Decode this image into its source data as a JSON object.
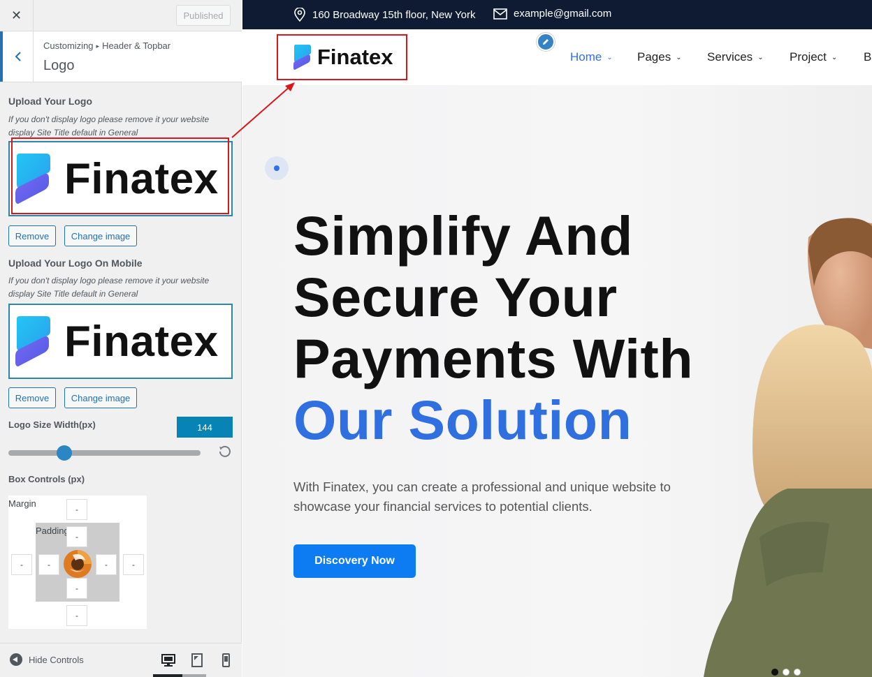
{
  "customizer": {
    "close_glyph": "✕",
    "published_label": "Published",
    "breadcrumb": {
      "root": "Customizing",
      "section": "Header & Topbar"
    },
    "section_title": "Logo",
    "logo": {
      "label": "Upload Your Logo",
      "description": "If you don't display logo please remove it your website display Site Title default in General",
      "preview_text": "Finatex",
      "remove_label": "Remove",
      "change_label": "Change image"
    },
    "mobile_logo": {
      "label": "Upload Your Logo On Mobile",
      "description": "If you don't display logo please remove it your website display Site Title default in General",
      "preview_text": "Finatex",
      "remove_label": "Remove",
      "change_label": "Change image"
    },
    "logo_width": {
      "label": "Logo Size Width(px)",
      "value": "144",
      "slider_fraction": 0.29
    },
    "box_controls": {
      "label": "Box Controls (px)",
      "margin_label": "Margin",
      "padding_label": "Padding",
      "margin": {
        "top": "-",
        "right": "-",
        "bottom": "-",
        "left": "-"
      },
      "padding": {
        "top": "-",
        "right": "-",
        "bottom": "-",
        "left": "-"
      }
    },
    "footer": {
      "hide_controls_label": "Hide Controls",
      "devices": [
        "desktop-icon",
        "tablet-icon",
        "mobile-icon"
      ]
    }
  },
  "site": {
    "topbar": {
      "address": "160 Broadway 15th floor, New York",
      "email": "example@gmail.com"
    },
    "brand": "Finatex",
    "nav": [
      {
        "label": "Home",
        "active": true
      },
      {
        "label": "Pages",
        "active": false
      },
      {
        "label": "Services",
        "active": false
      },
      {
        "label": "Project",
        "active": false
      },
      {
        "label": "Bl",
        "active": false
      }
    ],
    "hero": {
      "title_lines": [
        "Simplify And",
        "Secure Your",
        "Payments With"
      ],
      "title_highlight": "Our Solution",
      "description": "With Finatex, you can create a professional and unique website to showcase your financial services to potential clients.",
      "cta_label": "Discovery Now"
    },
    "slider_dots": 3
  },
  "colors": {
    "accent": "#2271b1",
    "topbar_bg": "#0e1b33",
    "highlight": "#2f6fe0",
    "cta_bg": "#0d7cf2",
    "annotation": "#d9161a"
  }
}
